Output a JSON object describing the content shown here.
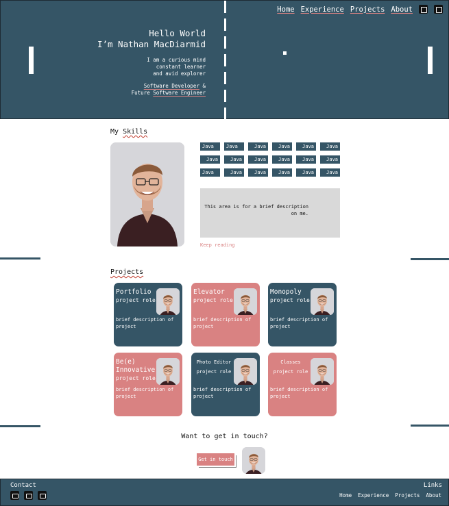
{
  "nav": {
    "links": [
      "Home",
      "Experience",
      "Projects",
      "About"
    ],
    "icons": [
      "linkedin-icon",
      "github-icon"
    ]
  },
  "hero": {
    "greeting": "Hello World",
    "name": "I’m Nathan MacDiarmid",
    "about_lines": [
      "I am a curious mind",
      "constant learner",
      "and avid explorer"
    ],
    "role_line1": "Software Developer",
    "role_line1_suffix": " &",
    "role_line2_prefix": "Future ",
    "role_line2": "Software Engineer"
  },
  "skills": {
    "title_prefix": "My ",
    "title_underlined": "Skills",
    "items": [
      "Java",
      "Java",
      "Java",
      "Java",
      "Java",
      "Java",
      "Java",
      "Java",
      "Java",
      "Java",
      "Java",
      "Java",
      "Java",
      "Java",
      "Java",
      "Java",
      "Java",
      "Java"
    ],
    "description": "This area is for a brief description on me.",
    "keep_reading": "Keep reading"
  },
  "projects": {
    "title": "Projects",
    "cards": [
      {
        "title": "Portfolio",
        "role": "project role",
        "desc": "brief description of project",
        "color": "navy"
      },
      {
        "title": "Elevator",
        "role": "project role",
        "desc": "brief description of project",
        "color": "pink"
      },
      {
        "title": "Monopoly",
        "role": "project role",
        "desc": "brief description of project",
        "color": "navy"
      },
      {
        "title": "Be(e) Innovative",
        "role": "project role",
        "desc": "brief description of project",
        "color": "pink"
      },
      {
        "title": "Photo Editor",
        "role": "project role",
        "desc": "brief description of project",
        "color": "navy"
      },
      {
        "title": "Classes",
        "role": "project role",
        "desc": "brief description of project",
        "color": "pink"
      }
    ]
  },
  "contact": {
    "question": "Want to get in touch?",
    "button": "Get in touch"
  },
  "footer": {
    "contact_label": "Contact",
    "contact_icons": [
      "mail-icon",
      "github-icon",
      "linkedin-icon"
    ],
    "links_label": "Links",
    "links": [
      "Home",
      "Experience",
      "Projects",
      "About"
    ]
  },
  "colors": {
    "navy": "#355566",
    "pink": "#d98282",
    "grey": "#d9d9d9"
  }
}
